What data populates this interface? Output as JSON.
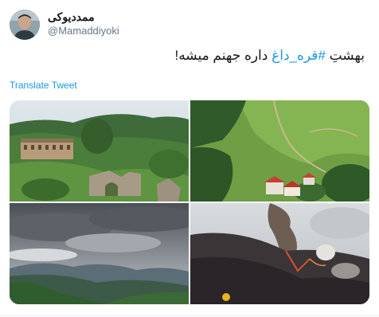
{
  "tweet": {
    "display_name": "ممددیوکی",
    "handle": "@Mamaddiyoki",
    "text_prefix": "بهشتِ ",
    "hashtag": "#قره_داغ",
    "text_suffix": " داره جهنم میشه!",
    "translate_label": "Translate Tweet",
    "link_color": "#1b95e0"
  },
  "media": {
    "photos": [
      {
        "description": "green-forest-ruins-photo"
      },
      {
        "description": "valley-village-photo"
      },
      {
        "description": "cloudy-mountains-photo"
      },
      {
        "description": "forest-fire-smoke-photo"
      }
    ]
  }
}
